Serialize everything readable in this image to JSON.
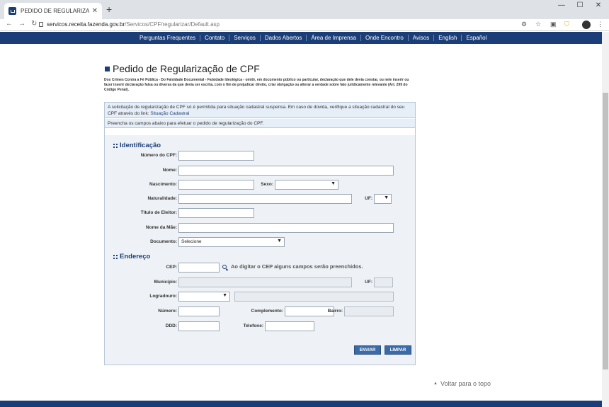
{
  "browser": {
    "tab_title": "PEDIDO DE REGULARIZAÇÃO DE",
    "url_domain": "servicos.receita.fazenda.gov.br",
    "url_path": "/Servicos/CPF/regularizar/Default.asp"
  },
  "topnav": {
    "items": [
      "Perguntas Frequentes",
      "Contato",
      "Serviços",
      "Dados Abertos",
      "Área de Imprensa",
      "Onde Encontro",
      "Avisos",
      "English",
      "Español"
    ]
  },
  "page": {
    "title": "Pedido de Regularização de CPF",
    "notice": "Dos Crimes Contra a Fé Pública - Do Falsidade Documental - Falsidade Ideológica - omitir, em documento público ou particular, declaração que dele devia constar, ou nele inserir ou fazer inserir declaração falsa ou diversa da que devia ser escrita, com o fim de prejudicar direito, criar obrigação ou alterar a verdade sobre fato juridicamente relevante (Art. 299 do Código Penal).",
    "info_text": "A solicitação de regularização de CPF só é permitida para situação cadastral suspensa. Em caso de dúvida, verifique a situação cadastral do seu CPF através do link:",
    "info_link": "Situação Cadastral",
    "instructions": "Preencha os campos abaixo para efetuar o pedido de regularização do CPF."
  },
  "identificacao": {
    "heading": "Identificação",
    "cpf_label": "Número do CPF:",
    "nome_label": "Nome:",
    "nascimento_label": "Nascimento:",
    "sexo_label": "Sexo:",
    "naturalidade_label": "Naturalidade:",
    "uf_label": "UF:",
    "titulo_label": "Título de Eleitor:",
    "mae_label": "Nome da Mãe:",
    "documento_label": "Documento:",
    "documento_value": "Selecione"
  },
  "endereco": {
    "heading": "Endereço",
    "cep_label": "CEP:",
    "cep_hint": "Ao digitar o CEP alguns campos serão preenchidos.",
    "municipio_label": "Município:",
    "uf_label": "UF:",
    "logradouro_label": "Logradouro:",
    "numero_label": "Número:",
    "complemento_label": "Complemento:",
    "bairro_label": "Bairro:",
    "ddd_label": "DDD:",
    "telefone_label": "Telefone:"
  },
  "buttons": {
    "enviar": "ENVIAR",
    "limpar": "LIMPAR"
  },
  "footer": {
    "voltar": "Voltar para o topo"
  }
}
